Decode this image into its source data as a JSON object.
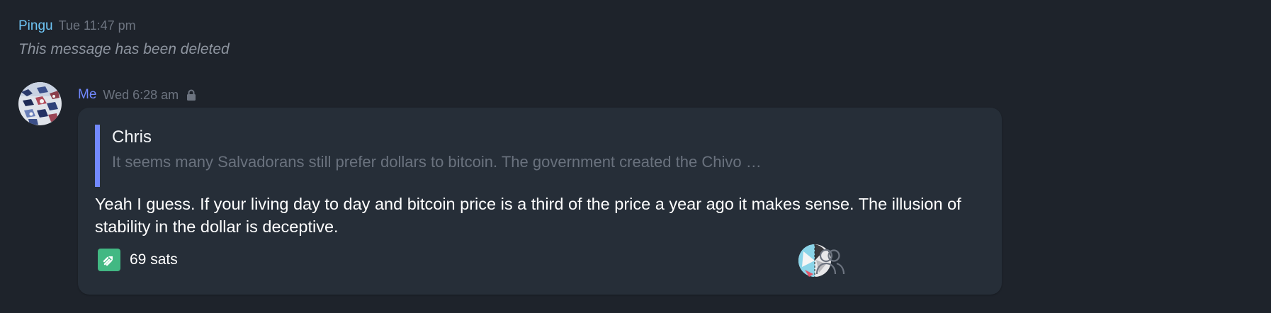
{
  "message_deleted": {
    "author": "Pingu",
    "timestamp": "Tue 11:47 pm",
    "text": "This message has been deleted"
  },
  "message_main": {
    "author": "Me",
    "timestamp": "Wed 6:28 am",
    "lock_icon": "lock-icon",
    "quote": {
      "author": "Chris",
      "text": "It seems many Salvadorans still prefer dollars to bitcoin. The government created the Chivo …"
    },
    "body": "Yeah I guess. If your living day to day and bitcoin price is a third  of the price a year ago it makes sense. The illusion of stability in the dollar is deceptive.",
    "zap": {
      "icon": "zap-icon",
      "label": "69 sats"
    },
    "reaction_icons": [
      "participant-avatar",
      "people-icon"
    ]
  },
  "colors": {
    "background": "#1e232b",
    "bubble": "#262e38",
    "pingu_name": "#6ec5f5",
    "me_name": "#7289ff",
    "quote_bar": "#7289ff",
    "zap_green": "#42b883"
  }
}
